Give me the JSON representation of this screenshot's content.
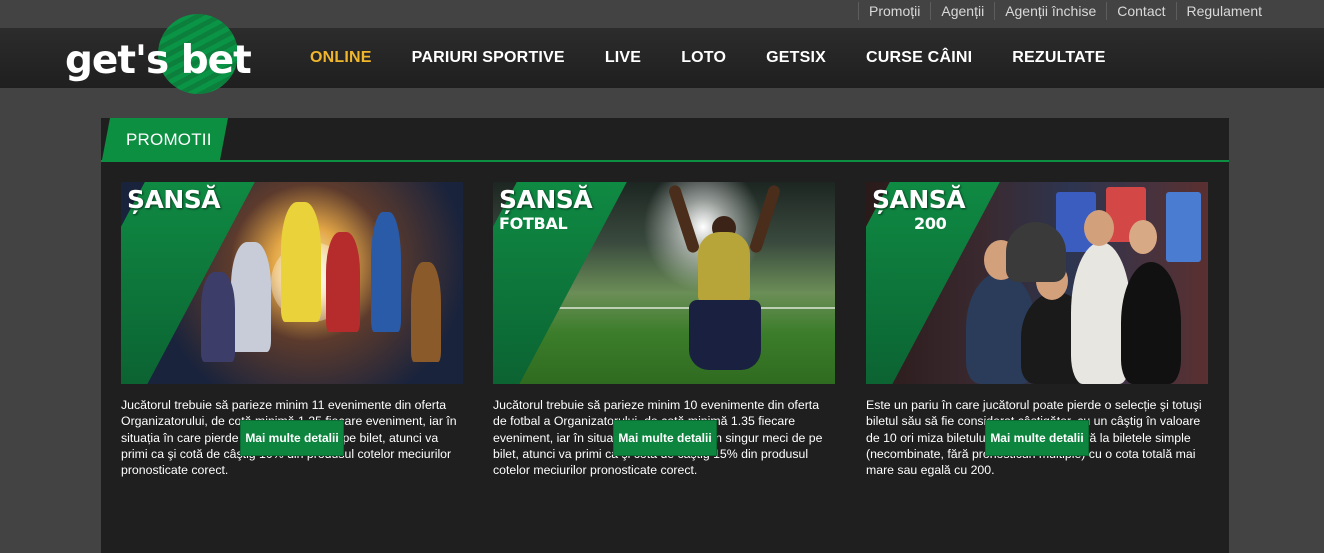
{
  "top_links": [
    "Promoții",
    "Agenții",
    "Agenții închise",
    "Contact",
    "Regulament"
  ],
  "logo": {
    "text": "get's bet"
  },
  "nav": [
    "ONLINE",
    "PARIURI SPORTIVE",
    "LIVE",
    "LOTO",
    "GETSIX",
    "CURSE CÂINI",
    "REZULTATE"
  ],
  "panel_title": "PROMOTII",
  "cards": [
    {
      "title": "ȘANSĂ",
      "subtitle": "",
      "text": "Jucătorul trebuie să parieze minim 11 evenimente din oferta Organizatorului, de cotă minimă 1.25 fiecare eveniment, iar în situația în care pierde un singur meci de pe bilet, atunci va primi ca şi cotă de câştig 10% din produsul cotelor meciurilor pronosticate corect.",
      "button": "Mai multe detalii"
    },
    {
      "title": "ȘANSĂ",
      "subtitle": "FOTBAL",
      "text": "Jucătorul trebuie să parieze minim 10 evenimente din oferta de fotbal a Organizatorului, de cotă minimă 1.35 fiecare eveniment, iar în situația în care pierde un singur meci de pe bilet, atunci va primi ca şi cotă de câştig 15% din produsul cotelor meciurilor pronosticate corect.",
      "button": "Mai multe detalii"
    },
    {
      "title": "ȘANSĂ",
      "subtitle": "200",
      "text": "Este un pariu în care jucătorul poate pierde o selecție şi totuşi biletul său să fie considerat câştigător, cu un câştig în valoare de 10 ori miza biletului. Promoţia se referă la biletele simple (necombinate, fără pronosticuri multiple) cu o cota totală mai mare sau egală cu 200.",
      "button": "Mai multe detalii"
    }
  ],
  "colors": {
    "accent_green": "#0d8f42",
    "active_nav": "#f0b62c",
    "page_bg": "#434343",
    "panel_bg": "#1f1f1f"
  }
}
